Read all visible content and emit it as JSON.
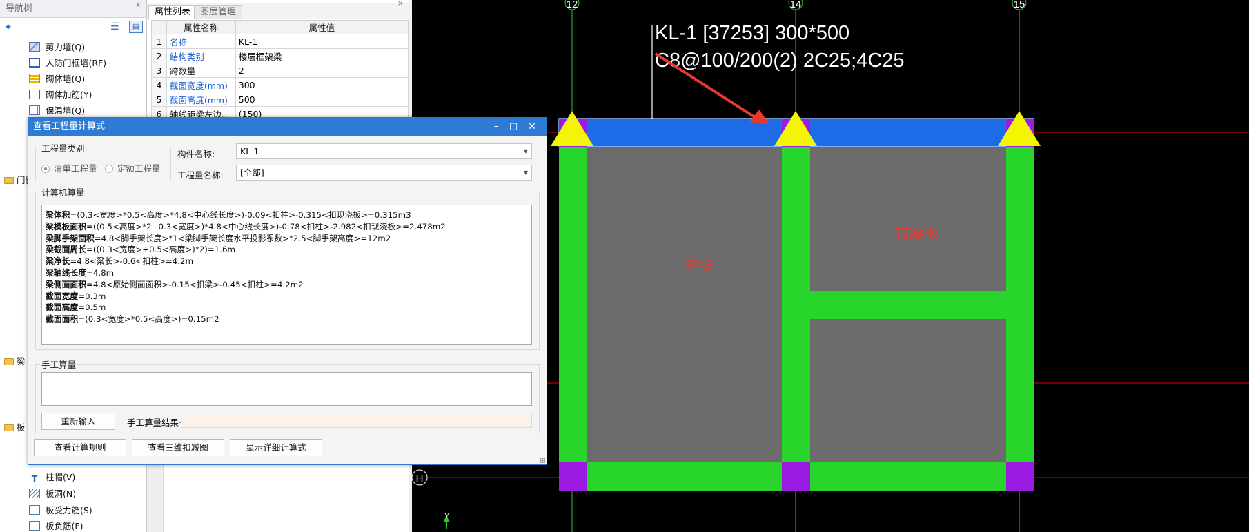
{
  "colors": {
    "dialog_title": "#2e7bd6",
    "beam_blue": "#1e6be8",
    "column_green": "#27d52b",
    "column_purple": "#9b1be3",
    "slab_gray": "#6b6b6b",
    "support_yellow": "#f4f500",
    "axis_green": "#2fc62f",
    "axis_red": "#e00000",
    "annotation_red": "#e63a2e",
    "link_blue": "#1f5fd6"
  },
  "nav": {
    "title": "导航树",
    "title_close": "×",
    "items_top": [
      {
        "label": "剪力墙(Q)",
        "icon": "shear-wall-icon"
      },
      {
        "label": "人防门框墙(RF)",
        "icon": "civil-defense-door-icon"
      },
      {
        "label": "砌体墙(Q)",
        "icon": "masonry-wall-icon"
      },
      {
        "label": "砌体加筋(Y)",
        "icon": "masonry-rebar-icon"
      },
      {
        "label": "保温墙(Q)",
        "icon": "insulation-wall-icon"
      }
    ],
    "groups": [
      {
        "label": "门窗"
      },
      {
        "label": "梁"
      },
      {
        "label": "板"
      }
    ],
    "items_bottom": [
      {
        "label": "柱帽(V)",
        "icon": "column-cap-icon"
      },
      {
        "label": "板洞(N)",
        "icon": "slab-hole-icon"
      },
      {
        "label": "板受力筋(S)",
        "icon": "slab-stress-rebar-icon"
      },
      {
        "label": "板负筋(F)",
        "icon": "slab-negative-rebar-icon"
      }
    ]
  },
  "props": {
    "tabs": [
      "属性列表",
      "图层管理"
    ],
    "close": "×",
    "headers": [
      "",
      "属性名称",
      "属性值"
    ],
    "rows": [
      {
        "num": "1",
        "name": "名称",
        "value": "KL-1",
        "blue": true
      },
      {
        "num": "2",
        "name": "结构类别",
        "value": "楼层框架梁",
        "blue": true
      },
      {
        "num": "3",
        "name": "跨数量",
        "value": "2",
        "blue": false
      },
      {
        "num": "4",
        "name": "截面宽度(mm)",
        "value": "300",
        "blue": true
      },
      {
        "num": "5",
        "name": "截面高度(mm)",
        "value": "500",
        "blue": true
      },
      {
        "num": "6",
        "name": "轴线距梁左边...",
        "value": "(150)",
        "blue": false
      }
    ]
  },
  "dialog": {
    "title": "查看工程量计算式",
    "controls": {
      "min": "–",
      "max": "□",
      "close": "✕"
    },
    "qty_type_label": "工程量类别",
    "radio_list": "清单工程量",
    "radio_quota": "定额工程量",
    "component_name_label": "构件名称:",
    "component_name_value": "KL-1",
    "qty_name_label": "工程量名称:",
    "qty_name_value": "[全部]",
    "computer_calc_label": "计算机算量",
    "calc_lines": [
      {
        "key": "梁体积",
        "expr": "=(0.3<宽度>*0.5<高度>*4.8<中心线长度>)-0.09<扣柱>-0.315<扣现浇板>=0.315m3"
      },
      {
        "key": "梁模板面积",
        "expr": "=((0.5<高度>*2+0.3<宽度>)*4.8<中心线长度>)-0.78<扣柱>-2.982<扣现浇板>=2.478m2"
      },
      {
        "key": "梁脚手架面积",
        "expr": "=4.8<脚手架长度>*1<梁脚手架长度水平投影系数>*2.5<脚手架高度>=12m2"
      },
      {
        "key": "梁截面周长",
        "expr": "=((0.3<宽度>+0.5<高度>)*2)=1.6m"
      },
      {
        "key": "梁净长",
        "expr": "=4.8<梁长>-0.6<扣柱>=4.2m"
      },
      {
        "key": "梁轴线长度",
        "expr": "=4.8m"
      },
      {
        "key": "梁侧面面积",
        "expr": "=4.8<原始侧面面积>-0.15<扣梁>-0.45<扣柱>=4.2m2"
      },
      {
        "key": "截面宽度",
        "expr": "=0.3m"
      },
      {
        "key": "截面高度",
        "expr": "=0.5m"
      },
      {
        "key": "截面面积",
        "expr": "=(0.3<宽度>*0.5<高度>)=0.15m2"
      }
    ],
    "manual_calc_label": "手工算量",
    "reenter_button": "重新输入",
    "manual_result_label": "手工算量结果=",
    "view_rules_button": "查看计算规则",
    "view_3d_button": "查看三维扣减图",
    "show_detail_button": "显示详细计算式"
  },
  "cad": {
    "axis_labels": [
      "12",
      "14",
      "15"
    ],
    "row_label": "H",
    "beam_text_line1": "KL-1 [37253] 300*500",
    "beam_text_line2": "C8@100/200(2) 2C25;4C25",
    "slab_label_left": "平板",
    "slab_label_right": "有梁板",
    "ucs_label": "Y"
  }
}
